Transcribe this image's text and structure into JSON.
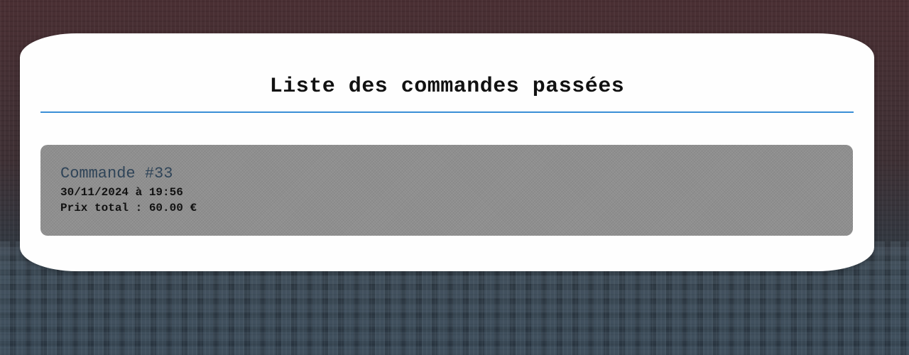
{
  "page": {
    "title": "Liste des commandes passées"
  },
  "orders": [
    {
      "name": "Commande #33",
      "datetime": "30/11/2024 à 19:56",
      "total": "Prix total : 60.00 €"
    }
  ],
  "colors": {
    "title_rule": "#3a8fd6",
    "order_name": "#2f4458",
    "card_bg": "#8f8f8f",
    "panel_bg": "#fefefe"
  }
}
